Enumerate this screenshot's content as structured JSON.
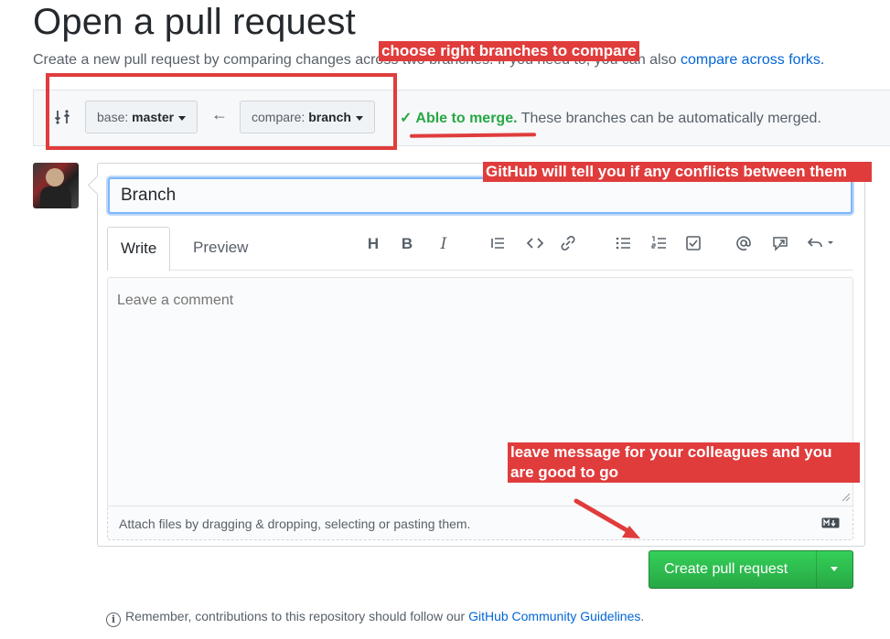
{
  "header": {
    "title": "Open a pull request",
    "subtitle": "Create a new pull request by comparing changes across two branches. If you need to, you can also ",
    "subtitle_link": "compare across forks."
  },
  "range": {
    "base_label": "base: ",
    "base_value": "master",
    "compare_label": "compare: ",
    "compare_value": "branch",
    "merge_strong": "Able to merge.",
    "merge_rest": " These branches can be automatically merged."
  },
  "form": {
    "title_value": "Branch",
    "tabs": [
      "Write",
      "Preview"
    ],
    "comment_placeholder": "Leave a comment",
    "attach_text": "Attach files by dragging & dropping, selecting or pasting them.",
    "toolbar_icons": [
      "header-icon",
      "bold-icon",
      "italic-icon",
      "quote-icon",
      "code-icon",
      "link-icon",
      "bulleted-list-icon",
      "numbered-list-icon",
      "task-list-icon",
      "mention-icon",
      "reference-icon",
      "reply-icon"
    ]
  },
  "actions": {
    "create_label": "Create pull request"
  },
  "footer": {
    "text": "Remember, contributions to this repository should follow our ",
    "link": "GitHub Community Guidelines",
    "end": "."
  },
  "annotations": {
    "compare": "choose right branches to compare",
    "conflicts": "GitHub will tell you if any conflicts between them",
    "message": "leave message for your colleagues and you are good to go"
  },
  "colors": {
    "annotation_red": "#e03c3c",
    "merge_green": "#28a745",
    "link_blue": "#0366d6",
    "button_green": "#2ea44f"
  }
}
